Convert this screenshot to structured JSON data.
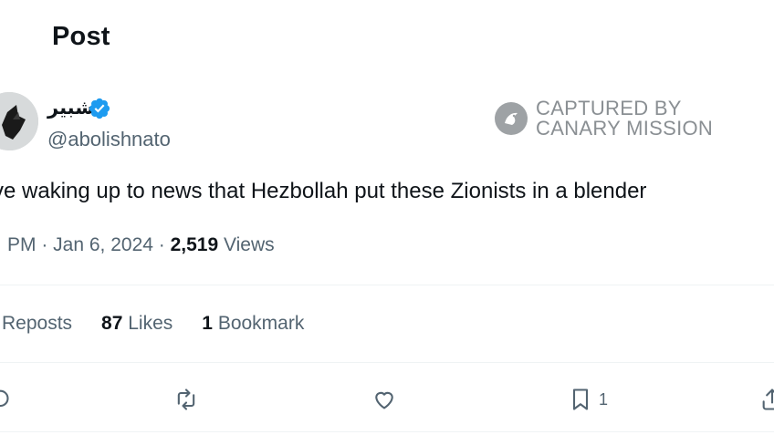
{
  "header": {
    "title": "Post"
  },
  "author": {
    "display_name": "شبير",
    "handle": "@abolishnato",
    "verified": true
  },
  "watermark": {
    "line1": "CAPTURED BY",
    "line2": "CANARY MISSION"
  },
  "tweet": {
    "text": "ve waking up to news that Hezbollah put these Zionists in a blender"
  },
  "meta": {
    "time": "PM",
    "date": "Jan 6, 2024",
    "views_count": "2,519",
    "views_label": "Views"
  },
  "stats": {
    "reposts_label": "Reposts",
    "likes_count": "87",
    "likes_label": "Likes",
    "bookmarks_count": "1",
    "bookmarks_label": "Bookmark"
  },
  "actions": {
    "bookmark_count": "1"
  },
  "colors": {
    "verified_blue": "#1d9bf0",
    "secondary_text": "#536471",
    "divider": "#eff3f4",
    "watermark_gray": "#8a8f93"
  }
}
